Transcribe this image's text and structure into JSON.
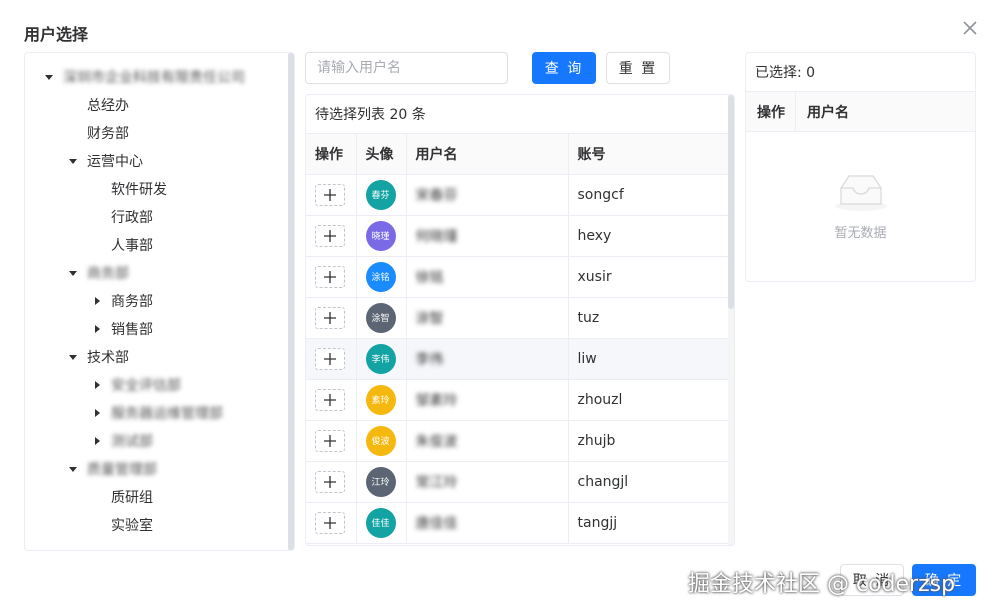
{
  "dialog": {
    "title": "用户选择"
  },
  "tree": {
    "nodes": [
      {
        "label": "深圳市企业科技有限责任公司",
        "expandable": true,
        "expanded": true,
        "blurred": true
      },
      {
        "label": "总经办",
        "expandable": false
      },
      {
        "label": "财务部",
        "expandable": false
      },
      {
        "label": "运营中心",
        "expandable": true,
        "expanded": true
      },
      {
        "label": "软件研发",
        "expandable": false
      },
      {
        "label": "行政部",
        "expandable": false
      },
      {
        "label": "人事部",
        "expandable": false
      },
      {
        "label": "商务部",
        "expandable": true,
        "expanded": true,
        "blurred": true
      },
      {
        "label": "商务部",
        "expandable": true,
        "expanded": false
      },
      {
        "label": "销售部",
        "expandable": true,
        "expanded": false
      },
      {
        "label": "技术部",
        "expandable": true,
        "expanded": true
      },
      {
        "label": "安全评估部",
        "expandable": true,
        "expanded": false,
        "blurred": true
      },
      {
        "label": "服务器运维管理部",
        "expandable": true,
        "expanded": false,
        "blurred": true
      },
      {
        "label": "测试部",
        "expandable": true,
        "expanded": false,
        "blurred": true
      },
      {
        "label": "质量管理部",
        "expandable": true,
        "expanded": true,
        "blurred": true
      },
      {
        "label": "质研组",
        "expandable": false
      },
      {
        "label": "实验室",
        "expandable": false
      }
    ]
  },
  "search": {
    "placeholder": "请输入用户名",
    "query_label": "查 询",
    "reset_label": "重 置"
  },
  "candidates": {
    "header": "待选择列表 20 条",
    "columns": [
      "操作",
      "头像",
      "用户名",
      "账号"
    ],
    "rows": [
      {
        "avatar": "春芬",
        "avatar_color": "#13a3a3",
        "username": "宋春芬",
        "account": "songcf"
      },
      {
        "avatar": "晓瑾",
        "avatar_color": "#7a6ae6",
        "username": "何晓瑾",
        "account": "hexy"
      },
      {
        "avatar": "涂铭",
        "avatar_color": "#1a8cff",
        "username": "徐铭",
        "account": "xusir"
      },
      {
        "avatar": "涂智",
        "avatar_color": "#5b6573",
        "username": "涂智",
        "account": "tuz"
      },
      {
        "avatar": "李伟",
        "avatar_color": "#13a3a3",
        "username": "李伟",
        "account": "liw"
      },
      {
        "avatar": "素玲",
        "avatar_color": "#f5b80f",
        "username": "邹素玲",
        "account": "zhouzl"
      },
      {
        "avatar": "俊波",
        "avatar_color": "#f5b80f",
        "username": "朱俊波",
        "account": "zhujb"
      },
      {
        "avatar": "江玲",
        "avatar_color": "#5b6573",
        "username": "常江玲",
        "account": "changjl"
      },
      {
        "avatar": "佳佳",
        "avatar_color": "#13a3a3",
        "username": "唐佳佳",
        "account": "tangjj"
      }
    ]
  },
  "selected": {
    "header": "已选择: 0",
    "columns": [
      "操作",
      "用户名"
    ],
    "empty_text": "暂无数据"
  },
  "footer": {
    "cancel_label": "取 消",
    "confirm_label": "确 定",
    "watermark": "掘金技术社区 @ coderzsp"
  }
}
